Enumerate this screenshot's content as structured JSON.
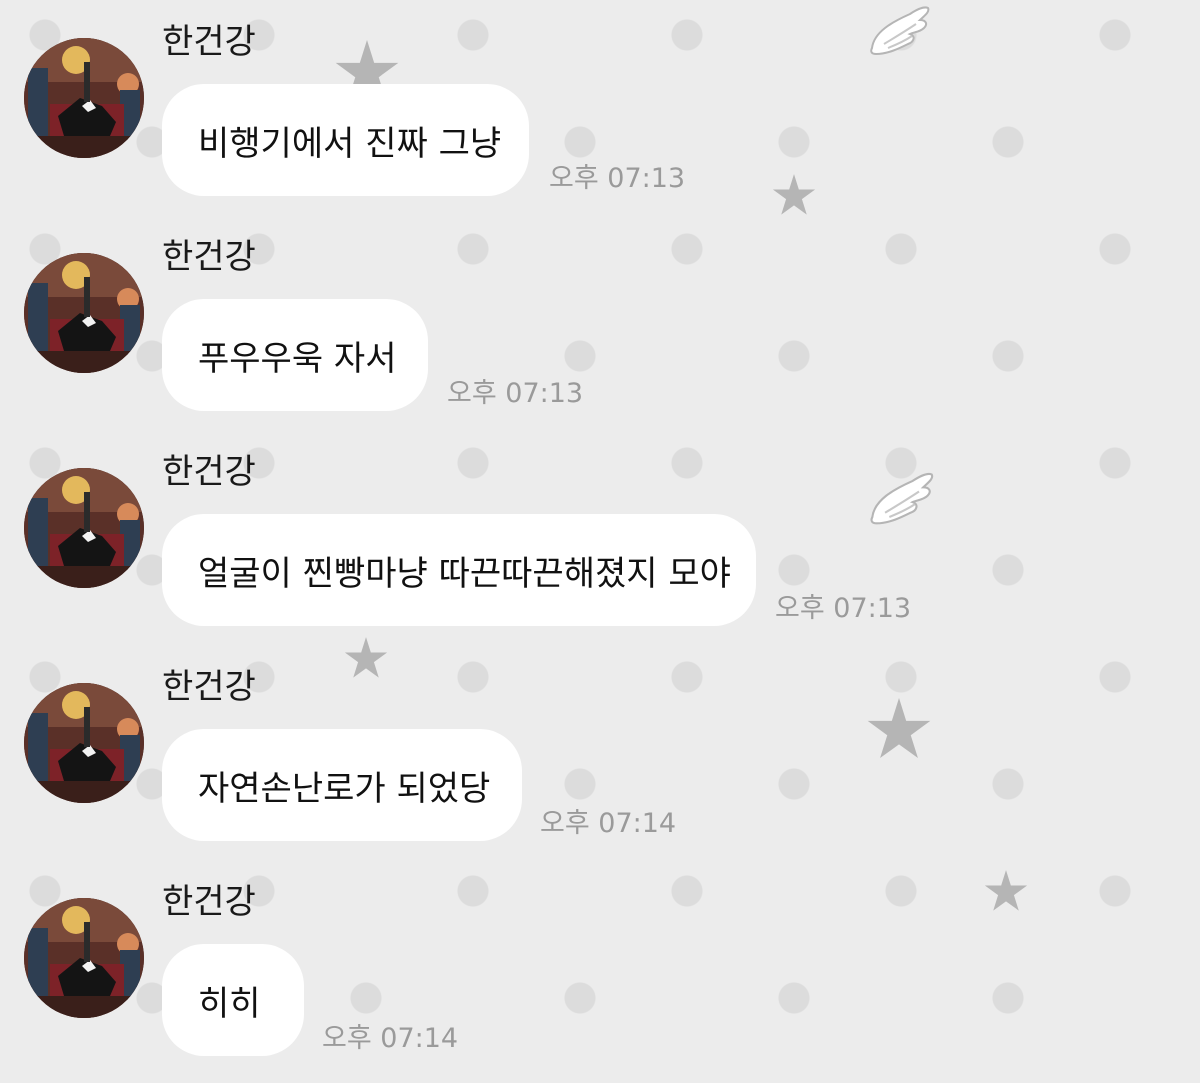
{
  "colors": {
    "background": "#ececec",
    "dot": "#dcdcdc",
    "bubble": "#ffffff",
    "timestamp": "#9a9a9a",
    "decoration": "#b5b5b5"
  },
  "messages": [
    {
      "sender": "한건강",
      "text": "비행기에서 진짜 그냥",
      "time": "오후 07:13"
    },
    {
      "sender": "한건강",
      "text": "푸우우욱 자서",
      "time": "오후 07:13"
    },
    {
      "sender": "한건강",
      "text": "얼굴이 찐빵마냥 따끈따끈해졌지 모야",
      "time": "오후 07:13"
    },
    {
      "sender": "한건강",
      "text": "자연손난로가 되었당",
      "time": "오후 07:14"
    },
    {
      "sender": "한건강",
      "text": "히히",
      "time": "오후 07:14"
    }
  ],
  "icons": {
    "avatar": "profile-photo",
    "decorations": [
      "star-icon",
      "wing-icon"
    ]
  }
}
